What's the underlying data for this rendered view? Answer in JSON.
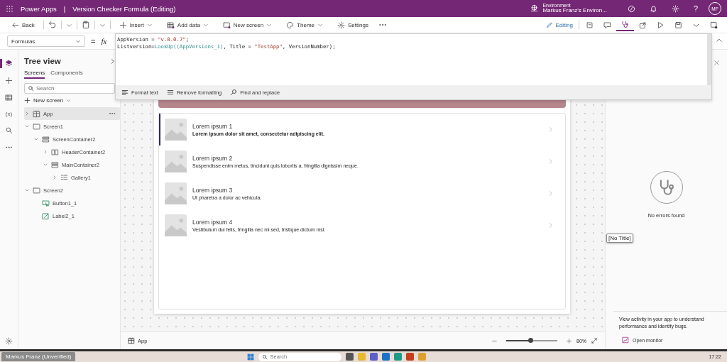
{
  "title_bar": {
    "app_name": "Power Apps",
    "separator": "|",
    "document": "Version Checker Formula (Editing)",
    "environment_label": "Environment",
    "environment": "Markus Franz's Environ...",
    "help": "?",
    "avatar": "MF"
  },
  "commands": [
    {
      "kind": "back",
      "label": "Back"
    },
    {
      "kind": "undo",
      "dropdown": true
    },
    {
      "kind": "paste",
      "dropdown": true
    },
    {
      "kind": "insert",
      "label": "Insert",
      "dropdown": true
    },
    {
      "kind": "add-data",
      "label": "Add data",
      "dropdown": true
    },
    {
      "kind": "new-screen",
      "label": "New screen",
      "dropdown": true
    },
    {
      "kind": "theme",
      "label": "Theme",
      "dropdown": true
    },
    {
      "kind": "settings",
      "label": "Settings"
    },
    {
      "kind": "more"
    }
  ],
  "mode": {
    "label": "Editing"
  },
  "toolbar_icons": [
    {
      "kind": "form",
      "selected": false
    },
    {
      "kind": "chat",
      "selected": false
    },
    {
      "kind": "checker",
      "selected": true
    },
    {
      "kind": "share",
      "selected": false
    },
    {
      "kind": "play",
      "selected": false
    },
    {
      "kind": "save",
      "selected": false
    },
    {
      "kind": "chevron",
      "selected": false
    },
    {
      "kind": "publish",
      "selected": false
    }
  ],
  "formula_bar": {
    "property": "Formulas",
    "equals": "=",
    "fx": "fx",
    "lines": [
      {
        "tokens": [
          {
            "kind": "plain",
            "text": "AppVersion = "
          },
          {
            "kind": "string",
            "text": "\"v.0.0.7\""
          },
          {
            "kind": "plain",
            "text": ";"
          }
        ]
      },
      {
        "tokens": [
          {
            "kind": "plain",
            "text": "Listversion="
          },
          {
            "kind": "function",
            "text": "LookUp((AppVersions_1)"
          },
          {
            "kind": "plain",
            "text": ", Title = "
          },
          {
            "kind": "string",
            "text": "\"TestApp\""
          },
          {
            "kind": "plain",
            "text": ", VersionNumber);"
          }
        ]
      }
    ],
    "tools": [
      {
        "kind": "format",
        "label": "Format text"
      },
      {
        "kind": "remove",
        "label": "Remove formatting"
      },
      {
        "kind": "find",
        "label": "Find and replace"
      }
    ]
  },
  "rail": [
    {
      "kind": "layers",
      "selected": true
    },
    {
      "kind": "insert",
      "selected": false
    },
    {
      "kind": "data",
      "selected": false
    },
    {
      "kind": "variables",
      "glyph": "(x)",
      "selected": false
    },
    {
      "kind": "search",
      "selected": false
    },
    {
      "kind": "more",
      "selected": false
    }
  ],
  "tree": {
    "title": "Tree view",
    "tabs": [
      {
        "label": "Screens",
        "selected": true
      },
      {
        "label": "Components",
        "selected": false
      }
    ],
    "search": {
      "placeholder": "Search"
    },
    "new_screen": "New screen",
    "items": [
      {
        "label": "App",
        "kind": "app",
        "expanded": false,
        "selected": true
      },
      {
        "label": "Screen1",
        "kind": "screen",
        "expanded": true,
        "selected": false,
        "children": [
          {
            "label": "ScreenContainer2",
            "kind": "vcontainer",
            "expanded": true,
            "selected": false,
            "children": [
              {
                "label": "HeaderContainer2",
                "kind": "hcontainer",
                "expanded": false,
                "selected": false
              },
              {
                "label": "MainContainer2",
                "kind": "vcontainer",
                "expanded": true,
                "selected": false,
                "children": [
                  {
                    "label": "Gallery1",
                    "kind": "gallery",
                    "expanded": false,
                    "selected": false
                  }
                ]
              }
            ]
          }
        ]
      },
      {
        "label": "Screen2",
        "kind": "screen",
        "expanded": true,
        "selected": false,
        "children": [
          {
            "label": "Button1_1",
            "kind": "button",
            "selected": false
          },
          {
            "label": "Label2_1",
            "kind": "label",
            "selected": false
          }
        ]
      }
    ]
  },
  "canvas": {
    "gallery": [
      {
        "title": "Lorem ipsum 1",
        "subtitle": "Lorem ipsum dolor sit amet, consectetur adipiscing elit.",
        "selected": true
      },
      {
        "title": "Lorem ipsum 2",
        "subtitle": "Suspendisse enim metus, tincidunt quis lobortis a, fringilla dignissim neque.",
        "selected": false
      },
      {
        "title": "Lorem ipsum 3",
        "subtitle": "Ut pharetra a dolor ac vehicula.",
        "selected": false
      },
      {
        "title": "Lorem ipsum 4",
        "subtitle": "Vestibulum dui felis, fringilla nec mi sed, tristique dictum nisi.",
        "selected": false
      }
    ],
    "tooltip": "[No Title]",
    "footer": {
      "screen": "App",
      "zoom": {
        "level": 0.47
      },
      "zoom_text": "80%"
    }
  },
  "right_panel": {
    "status": "No errors found",
    "hint": "View activity in your app to understand performance and identify bugs.",
    "link": "Open monitor"
  },
  "taskbar": {
    "tab": "Markus Franz (Unverified)",
    "search": {
      "placeholder": "Search"
    },
    "time": "17:22"
  }
}
